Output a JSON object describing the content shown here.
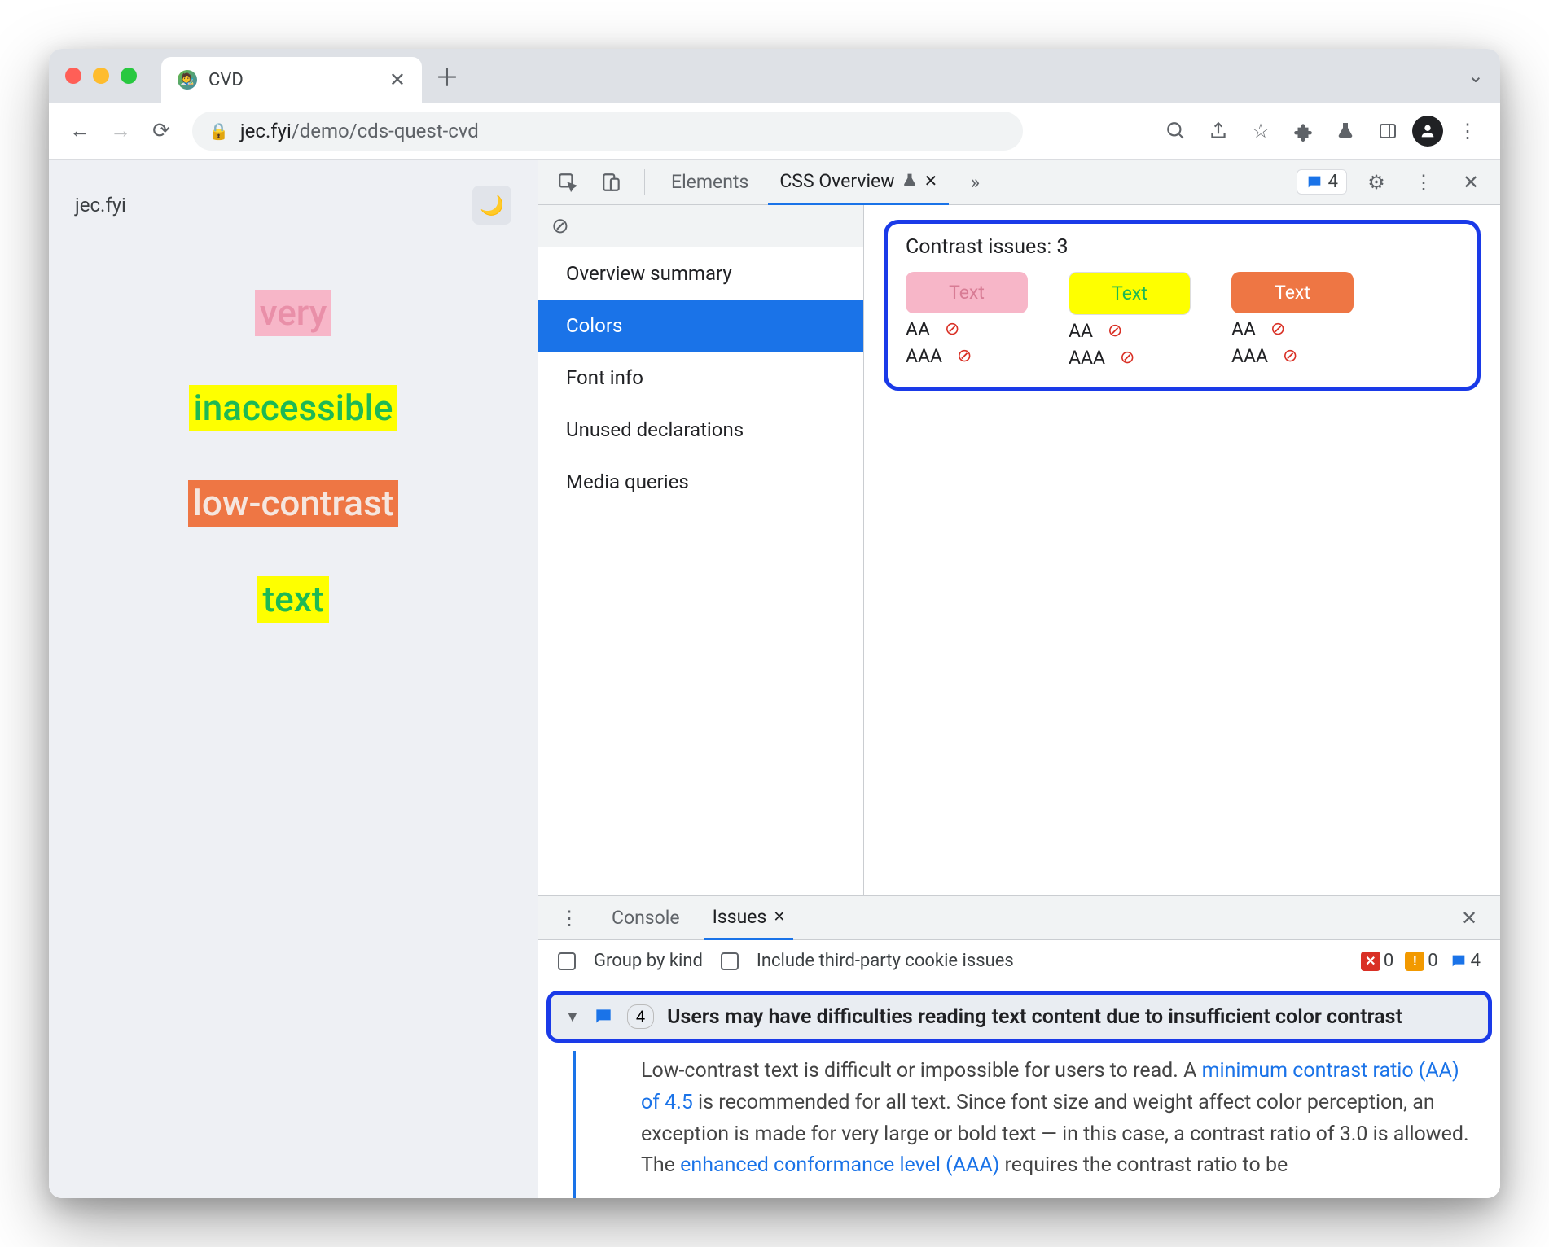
{
  "browser": {
    "tab_title": "CVD",
    "url_domain": "jec.fyi",
    "url_path": "/demo/cds-quest-cvd"
  },
  "page": {
    "site_name": "jec.fyi",
    "samples": [
      "very",
      "inaccessible",
      "low-contrast",
      "text"
    ]
  },
  "devtools": {
    "tabs": {
      "elements": "Elements",
      "css_overview": "CSS Overview"
    },
    "issue_count": "4",
    "sidebar": {
      "items": [
        "Overview summary",
        "Colors",
        "Font info",
        "Unused declarations",
        "Media queries"
      ],
      "selected": 1
    },
    "contrast": {
      "title": "Contrast issues: 3",
      "swatches": [
        {
          "label": "Text",
          "aa": "AA",
          "aaa": "AAA"
        },
        {
          "label": "Text",
          "aa": "AA",
          "aaa": "AAA"
        },
        {
          "label": "Text",
          "aa": "AA",
          "aaa": "AAA"
        }
      ]
    }
  },
  "drawer": {
    "tabs": {
      "console": "Console",
      "issues": "Issues"
    },
    "group_by_kind": "Group by kind",
    "include_third_party": "Include third-party cookie issues",
    "counts": {
      "errors": "0",
      "warnings": "0",
      "issues": "4"
    },
    "issue": {
      "count": "4",
      "title": "Users may have difficulties reading text content due to insufficient color contrast",
      "body_pre": "Low-contrast text is difficult or impossible for users to read. A ",
      "link1": "minimum contrast ratio (AA) of 4.5",
      "body_mid": " is recommended for all text. Since font size and weight affect color perception, an exception is made for very large or bold text — in this case, a contrast ratio of 3.0 is allowed. The ",
      "link2": "enhanced conformance level (AAA)",
      "body_post": " requires the contrast ratio to be"
    }
  }
}
